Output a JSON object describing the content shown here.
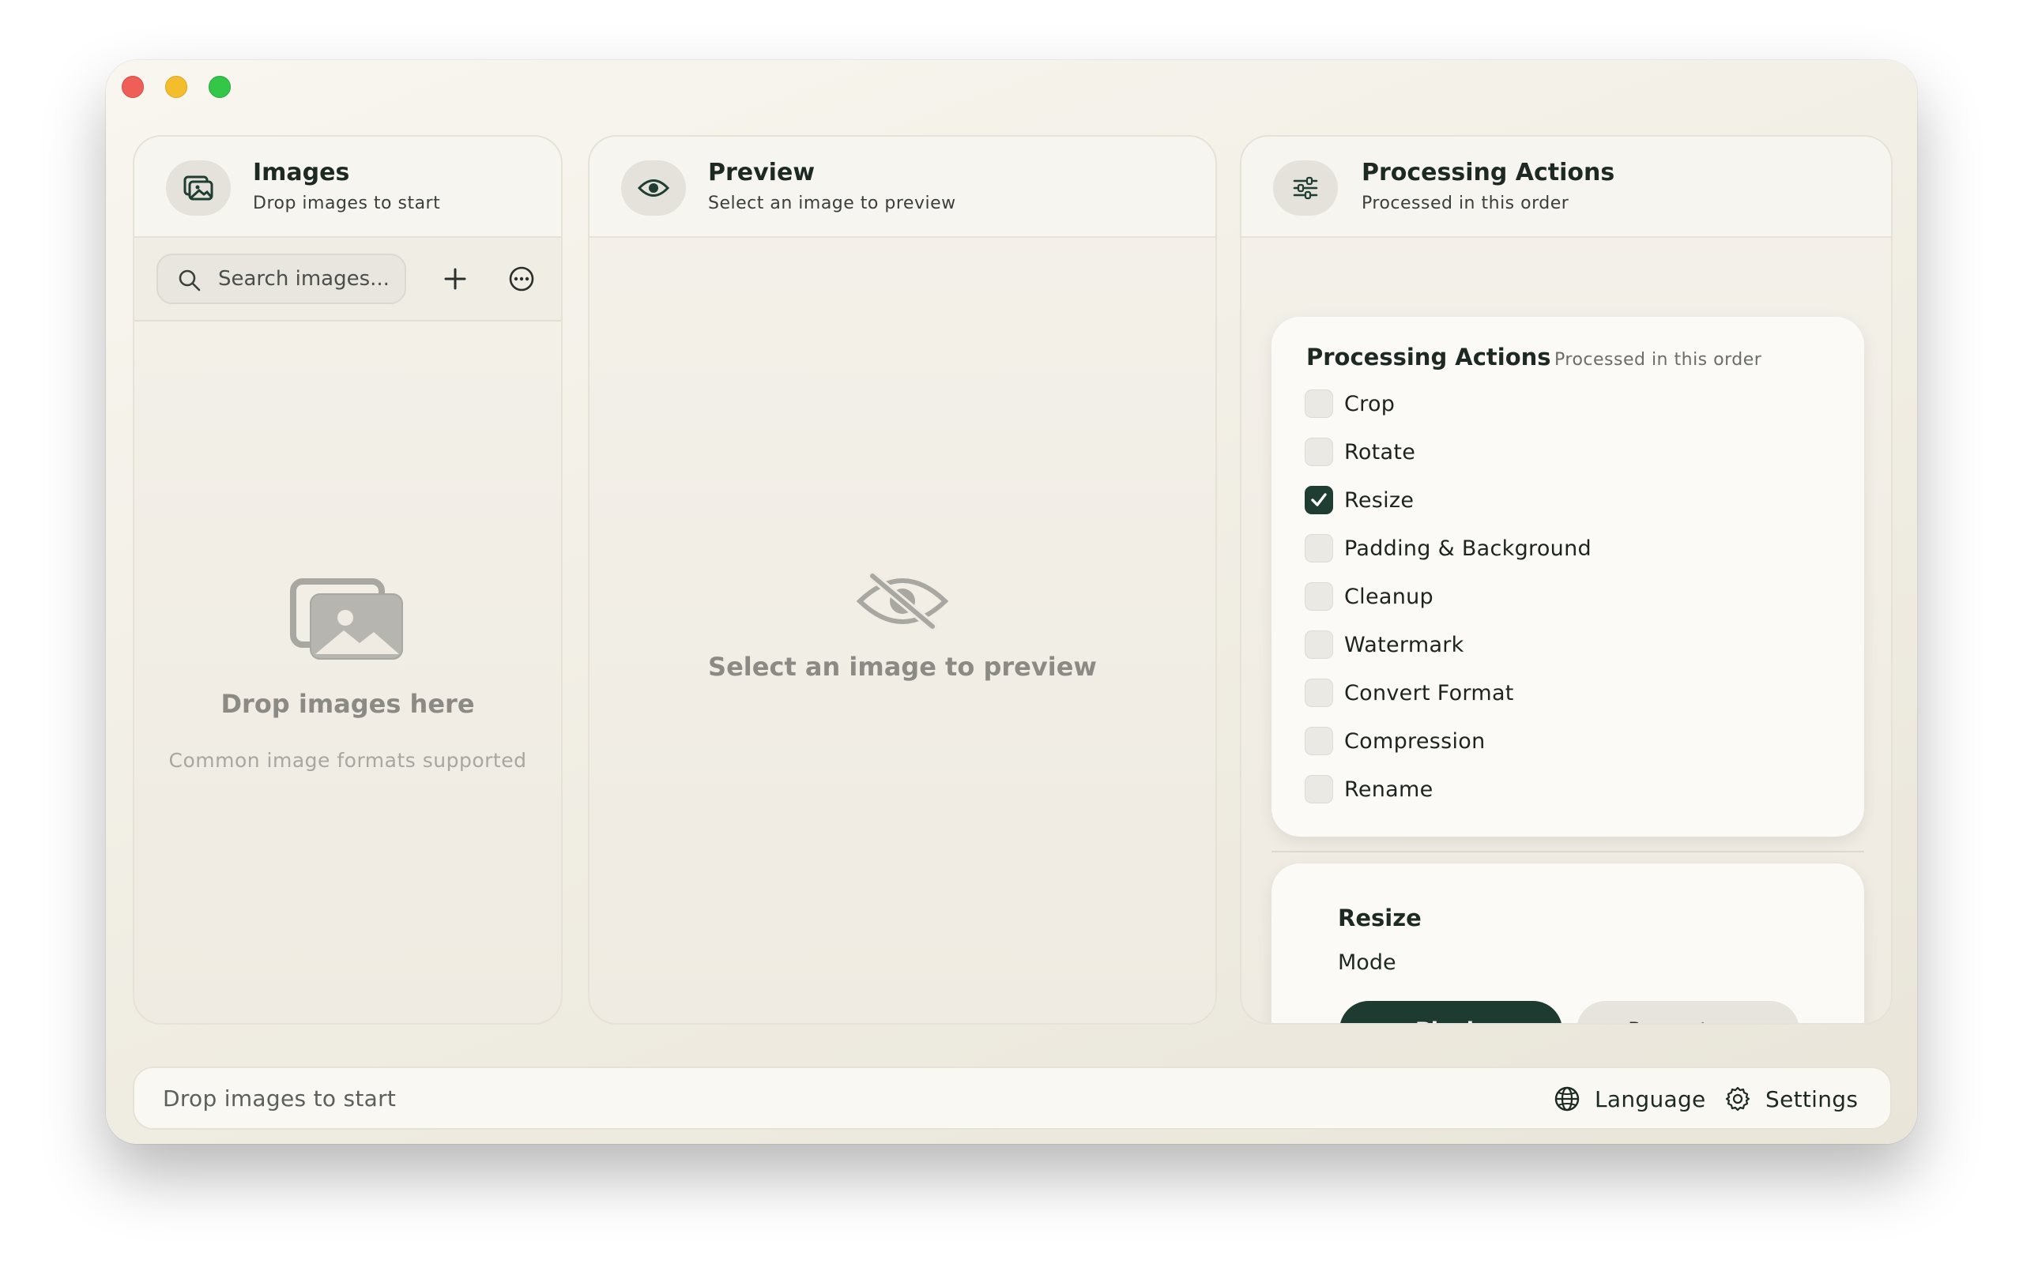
{
  "window": {
    "colors": {
      "accent": "#1e3b31",
      "background": "#f0ede3"
    }
  },
  "images_panel": {
    "title": "Images",
    "subtitle": "Drop images to start",
    "header_icon": "photo-stack-icon",
    "search": {
      "placeholder": "Search images...",
      "value": ""
    },
    "add_icon": "plus-icon",
    "more_icon": "ellipsis-circle-icon",
    "empty_icon": "photos-icon",
    "empty_title": "Drop images here",
    "empty_subtitle": "Common image formats supported"
  },
  "preview_panel": {
    "title": "Preview",
    "subtitle": "Select an image to preview",
    "header_icon": "eye-icon",
    "empty_icon": "eye-slash-icon",
    "empty_text": "Select an image to preview"
  },
  "actions_panel": {
    "title": "Processing Actions",
    "subtitle": "Processed in this order",
    "header_icon": "sliders-icon",
    "card_title": "Processing Actions",
    "card_subtitle": "Processed in this order",
    "actions": [
      {
        "label": "Crop",
        "checked": false
      },
      {
        "label": "Rotate",
        "checked": false
      },
      {
        "label": "Resize",
        "checked": true
      },
      {
        "label": "Padding & Background",
        "checked": false
      },
      {
        "label": "Cleanup",
        "checked": false
      },
      {
        "label": "Watermark",
        "checked": false
      },
      {
        "label": "Convert Format",
        "checked": false
      },
      {
        "label": "Compression",
        "checked": false
      },
      {
        "label": "Rename",
        "checked": false
      }
    ],
    "resize": {
      "title": "Resize",
      "mode_label": "Mode",
      "modes": [
        "Pixels",
        "Percentage"
      ],
      "selected_mode": "Pixels"
    }
  },
  "statusbar": {
    "text": "Drop images to start",
    "language_label": "Language",
    "language_icon": "globe-icon",
    "settings_label": "Settings",
    "settings_icon": "gear-icon"
  }
}
